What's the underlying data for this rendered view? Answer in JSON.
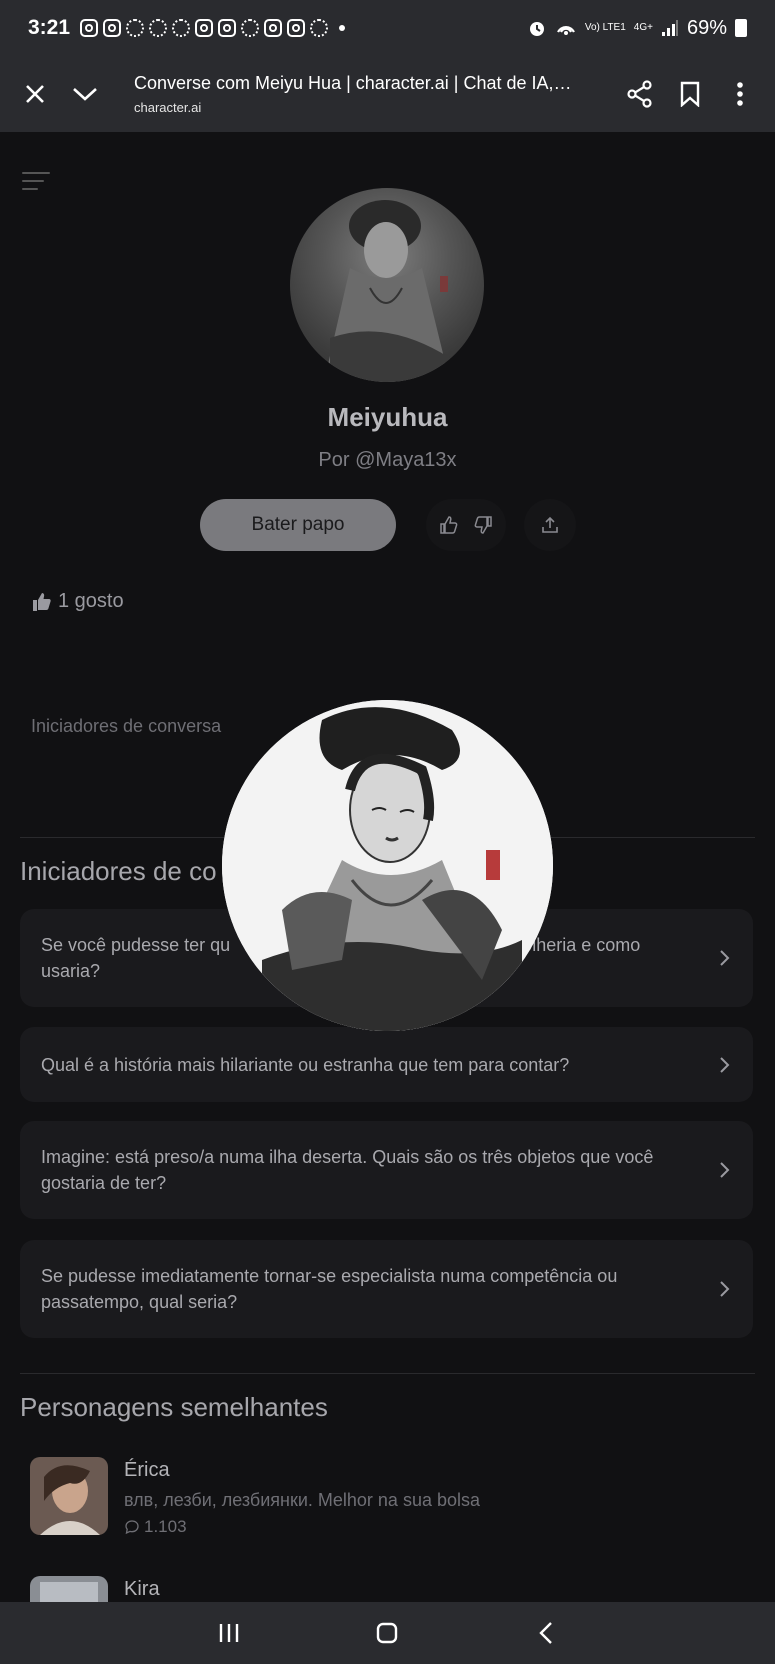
{
  "status_bar": {
    "time": "3:21",
    "network": "4G+",
    "lte": "Vo) LTE1",
    "battery": "69%"
  },
  "browser": {
    "title": "Converse com Meiyu Hua | character.ai | Chat de IA, refo...",
    "domain": "character.ai"
  },
  "character": {
    "name": "Meiyuhua",
    "author": "Por @Maya13x",
    "chat_button": "Bater papo",
    "likes": "1 gosto"
  },
  "starters": {
    "small_label": "Iniciadores de conversa",
    "title": "Iniciadores de co",
    "items": [
      {
        "text": "Se você pudesse ter qu                                                   l escolheria e como usaria?"
      },
      {
        "text": "Qual é a história mais hilariante ou estranha que tem para contar?"
      },
      {
        "text": "Imagine: está preso/a numa ilha deserta. Quais são os três objetos que você gostaria de ter?"
      },
      {
        "text": "Se pudesse imediatamente tornar-se especialista numa competência ou passatempo, qual seria?"
      }
    ]
  },
  "similar": {
    "title": "Personagens semelhantes",
    "items": [
      {
        "name": "Érica",
        "desc": "влв, лезби, лезбиянки. Melhor na sua bolsa",
        "count": "1.103"
      },
      {
        "name": "Kira"
      }
    ]
  },
  "icons": {
    "close": "close-icon",
    "collapse": "chevron-down-icon",
    "share": "share-icon",
    "bookmark": "bookmark-icon",
    "more": "more-vertical-icon",
    "menu": "menu-icon",
    "like": "thumbs-up-icon",
    "dislike": "thumbs-down-icon",
    "upload": "upload-icon",
    "chevron": "chevron-right-icon",
    "chat": "chat-bubble-icon"
  }
}
